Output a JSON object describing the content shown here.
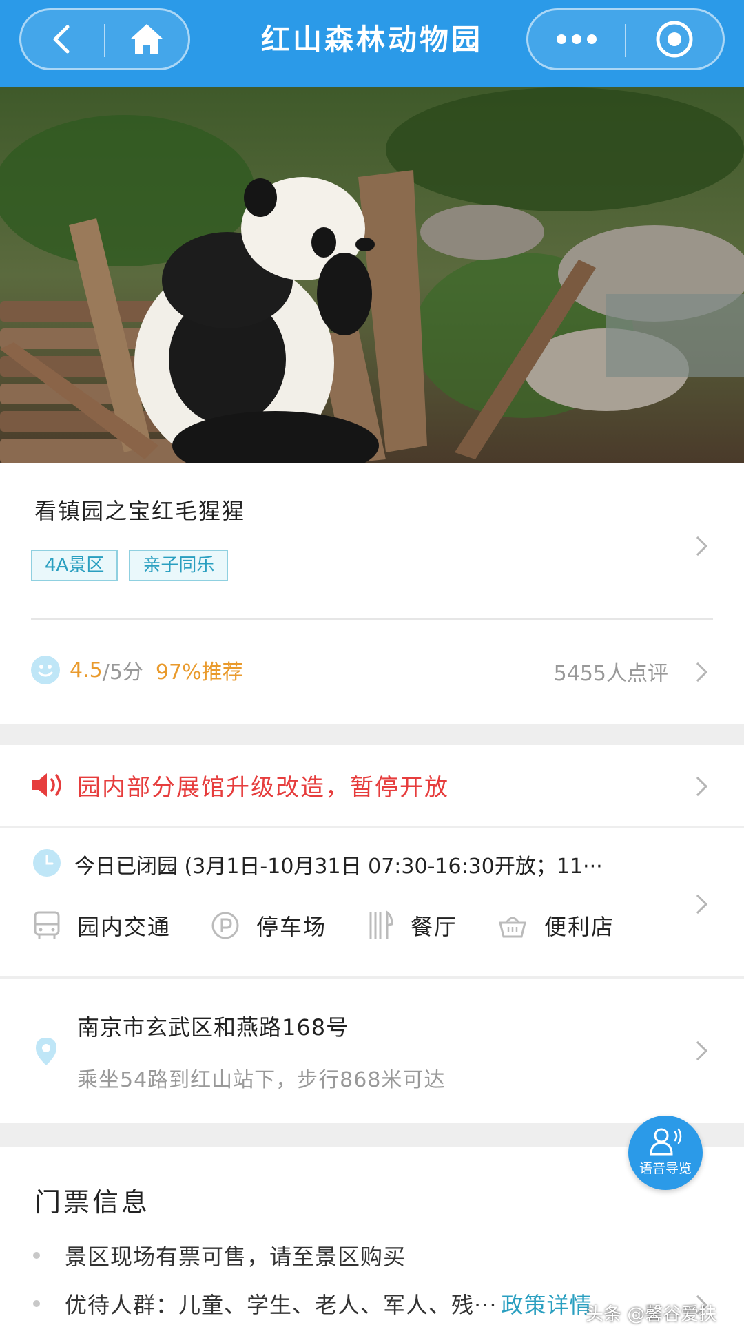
{
  "header": {
    "title": "红山森林动物园",
    "back_icon": "chevron-left-icon",
    "home_icon": "home-icon",
    "more_icon": "more-dots-icon",
    "close_icon": "target-circle-icon"
  },
  "hero": {
    "subject": "giant panda"
  },
  "attraction": {
    "name": "看镇园之宝红毛猩猩",
    "tags": [
      "4A景区",
      "亲子同乐"
    ]
  },
  "rating": {
    "score": "4.5",
    "score_max": "/5分",
    "recommend": "97%推荐",
    "review_count": "5455人点评"
  },
  "notice": {
    "text": "园内部分展馆升级改造，暂停开放",
    "color": "#e63d3d"
  },
  "hours": {
    "text": "今日已闭园 (3月1日-10月31日 07:30-16:30开放；11···"
  },
  "facilities": [
    {
      "label": "园内交通",
      "icon": "bus-icon"
    },
    {
      "label": "停车场",
      "icon": "parking-icon"
    },
    {
      "label": "餐厅",
      "icon": "fork-knife-icon"
    },
    {
      "label": "便利店",
      "icon": "shopping-basket-icon"
    }
  ],
  "address": {
    "main": "南京市玄武区和燕路168号",
    "sub": "乘坐54路到红山站下，步行868米可达"
  },
  "tickets": {
    "title": "门票信息",
    "items": [
      {
        "text": "景区现场有票可售，请至景区购买"
      },
      {
        "text": "优待人群：儿童、学生、老人、军人、残···",
        "link": "政策详情"
      }
    ]
  },
  "voice_guide": {
    "label": "语音导览"
  },
  "watermark": "头条 @馨谷爱扶",
  "colors": {
    "brand_blue": "#2b9ae8",
    "orange": "#e99a2c",
    "tag_text": "#2a9fc0"
  }
}
